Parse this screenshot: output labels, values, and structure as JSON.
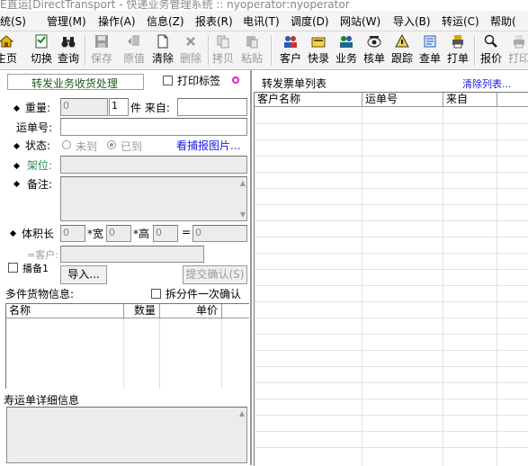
{
  "window": {
    "title": "E直运[DirectTransport - 快递业务管理系统 :: nyoperator:nyoperator"
  },
  "menu": [
    "统(S)",
    "管理(M)",
    "操作(A)",
    "信息(Z)",
    "报表(R)",
    "电讯(T)",
    "调度(D)",
    "网站(W)",
    "导入(B)",
    "转运(C)",
    "帮助("
  ],
  "toolbar": [
    {
      "label": "主页",
      "icon": "home-icon",
      "enabled": true
    },
    {
      "label": "切换",
      "icon": "switch-icon",
      "enabled": true
    },
    {
      "label": "查询",
      "icon": "binoculars-icon",
      "enabled": true
    },
    {
      "label": "保存",
      "icon": "save-icon",
      "enabled": false
    },
    {
      "label": "原值",
      "icon": "undo-icon",
      "enabled": false
    },
    {
      "label": "清除",
      "icon": "clear-icon",
      "enabled": true
    },
    {
      "label": "删除",
      "icon": "delete-icon",
      "enabled": false
    },
    {
      "label": "拷贝",
      "icon": "copy-icon",
      "enabled": false
    },
    {
      "label": "粘贴",
      "icon": "paste-icon",
      "enabled": false
    },
    {
      "label": "客户",
      "icon": "customers-icon",
      "enabled": true
    },
    {
      "label": "快录",
      "icon": "quick-entry-icon",
      "enabled": true
    },
    {
      "label": "业务",
      "icon": "business-icon",
      "enabled": true
    },
    {
      "label": "核单",
      "icon": "verify-icon",
      "enabled": true
    },
    {
      "label": "跟踪",
      "icon": "track-icon",
      "enabled": true
    },
    {
      "label": "查单",
      "icon": "lookup-icon",
      "enabled": true
    },
    {
      "label": "打单",
      "icon": "print-order-icon",
      "enabled": true
    },
    {
      "label": "报价",
      "icon": "quote-icon",
      "enabled": true
    },
    {
      "label": "打印",
      "icon": "print-icon",
      "enabled": false
    }
  ],
  "left": {
    "panel_title": "转发业务收货处理",
    "print_label": "打印标签",
    "weight_label": "重量:",
    "weight_value": "0",
    "pieces_value": "1",
    "pieces_label": "件 来自:",
    "from_value": "",
    "waybill_label": "运单号:",
    "waybill_value": "",
    "status_label": "状态:",
    "status_opt1": "未到",
    "status_opt2": "已到",
    "view_photo_link": "看捕报图片...",
    "shelf_label": "架位:",
    "remark_label": "备注:",
    "volume_label": "体积长",
    "length_value": "0",
    "width_label": "*宽",
    "width_value": "0",
    "height_label": "*高",
    "height_value": "0",
    "equals_label": "=",
    "volume_value": "0",
    "customer_label": "=客户:",
    "broadcast_label": "播备1",
    "import_button": "导入...",
    "submit_button": "提交确认(S)",
    "multi_goods_label": "多件货物信息:",
    "split_confirm_label": "拆分件一次确认",
    "goods_columns": [
      "名称",
      "数量",
      "单价"
    ],
    "detail_label": "寿运单详细信息"
  },
  "right": {
    "title": "转发票单列表",
    "clear_link": "清除列表...",
    "columns": [
      "客户名称",
      "运单号",
      "来自",
      ""
    ]
  },
  "colors": {
    "link": "#1a1adc",
    "title_bar": "#888888",
    "shelf_green": "#2e8b57"
  }
}
